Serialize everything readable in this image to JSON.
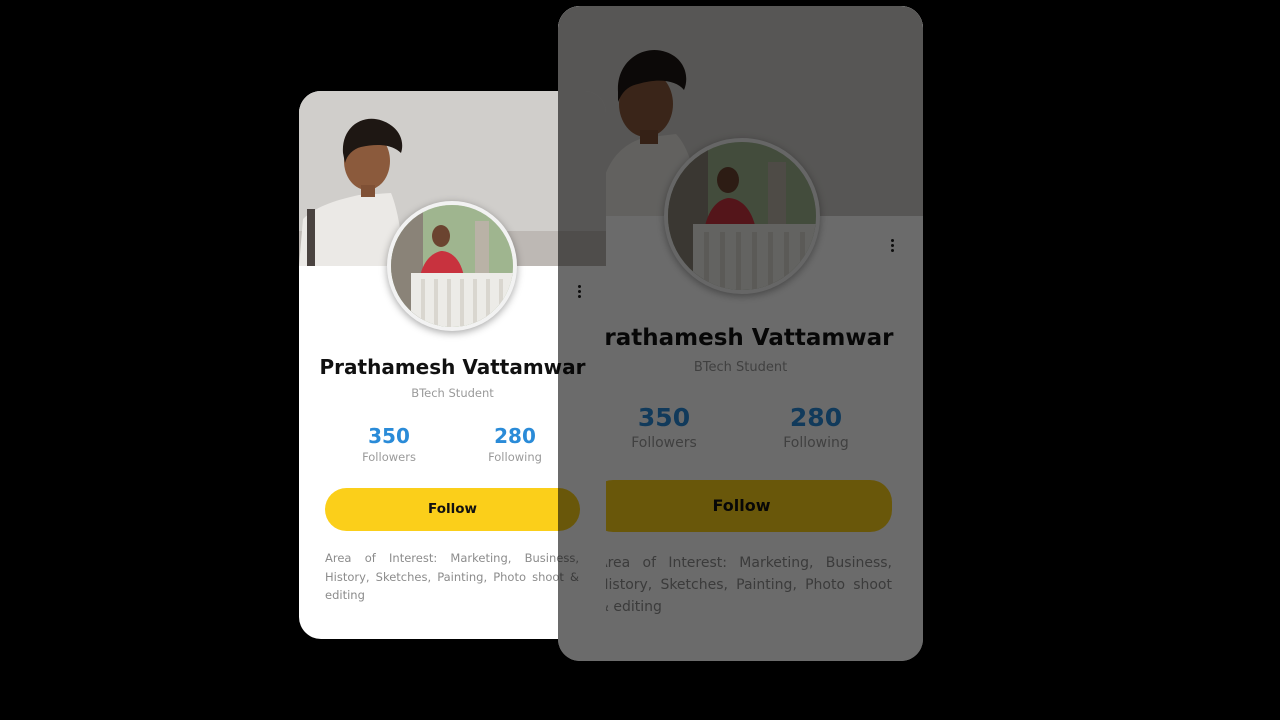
{
  "profile": {
    "name": "Prathamesh Vattamwar",
    "role": "BTech Student",
    "followers_count": "350",
    "followers_label": "Followers",
    "following_count": "280",
    "following_label": "Following",
    "follow_label": "Follow",
    "interests": "Area of Interest: Marketing, Business, History, Sketches, Painting, Photo shoot & editing"
  },
  "icons": {
    "menu": "more-vertical-icon",
    "cover": "cover-photo",
    "avatar": "avatar-photo"
  },
  "colors": {
    "accent_yellow": "#fbcf1a",
    "stat_blue": "#2a8bd8",
    "background": "#000000",
    "card": "#ffffff"
  }
}
